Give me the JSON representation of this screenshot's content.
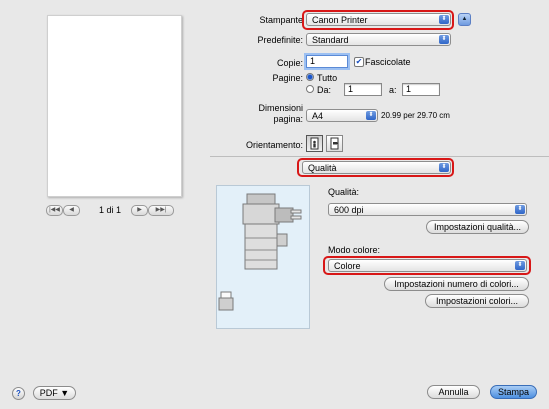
{
  "preview": {
    "page_counter": "1 di 1"
  },
  "printer": {
    "label": "Stampante",
    "value": "Canon Printer"
  },
  "presets": {
    "label": "Predefinite:",
    "value": "Standard"
  },
  "copies": {
    "label": "Copie:",
    "value": "1",
    "collate_label": "Fascicolate",
    "collated": true
  },
  "pages": {
    "label": "Pagine:",
    "all_label": "Tutto",
    "from_label": "Da:",
    "from_value": "1",
    "to_label": "a:",
    "to_value": "1"
  },
  "paper": {
    "label_line1": "Dimensioni",
    "label_line2": "pagina:",
    "value": "A4",
    "dimensions": "20.99 per 29.70 cm"
  },
  "orientation": {
    "label": "Orientamento:"
  },
  "panel": {
    "value": "Qualità"
  },
  "quality": {
    "label": "Qualità:",
    "value": "600 dpi",
    "settings_button": "Impostazioni qualità..."
  },
  "color_mode": {
    "label": "Modo colore:",
    "value": "Colore",
    "color_count_button": "Impostazioni numero di colori...",
    "color_settings_button": "Impostazioni colori..."
  },
  "footer": {
    "help": "?",
    "pdf_label": "PDF ▼",
    "cancel_label": "Annulla",
    "print_label": "Stampa"
  },
  "colors": {
    "highlight_ring": "#d81717",
    "default_button": "#4d8fe0",
    "popup_arrow": "#2f66c8"
  }
}
